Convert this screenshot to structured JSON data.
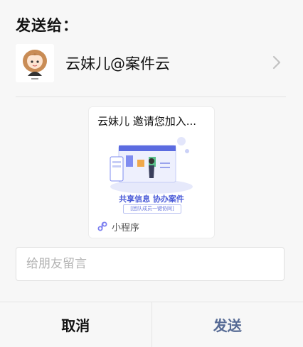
{
  "header": {
    "title": "发送给："
  },
  "recipient": {
    "name": "云妹儿@案件云",
    "avatar_icon": "girl-avatar-icon"
  },
  "card": {
    "title": "云妹儿 邀请您加入...",
    "tagline": "共享信息 协办案件",
    "subtitle": "[团队成员一键协同]",
    "footer_label": "小程序",
    "footer_icon": "mini-program-icon"
  },
  "message": {
    "placeholder": "给朋友留言"
  },
  "actions": {
    "cancel_label": "取消",
    "send_label": "发送"
  },
  "colors": {
    "accent": "#576b95",
    "card_brand": "#4a5bd8"
  }
}
